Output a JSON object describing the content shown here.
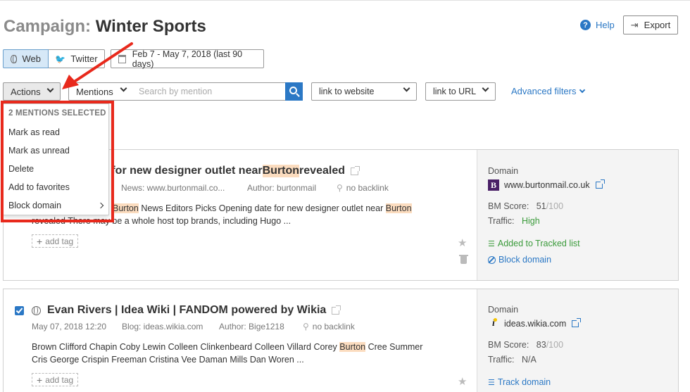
{
  "header": {
    "title_prefix": "Campaign:",
    "title_name": "Winter Sports",
    "help_label": "Help",
    "export_label": "Export"
  },
  "source_tabs": [
    {
      "label": "Web",
      "active": true
    },
    {
      "label": "Twitter",
      "active": false
    }
  ],
  "date_range": "Feb 7 - May 7, 2018 (last 90 days)",
  "filters": {
    "actions_label": "Actions",
    "mentions_label": "Mentions",
    "search_placeholder": "Search by mention",
    "link_to_website": "link to website",
    "link_to_url": "link to URL",
    "advanced_filters": "Advanced filters"
  },
  "actions_menu": {
    "header": "2 MENTIONS SELECTED",
    "items": [
      "Mark as read",
      "Mark as unread",
      "Delete",
      "Add to favorites",
      "Block domain"
    ]
  },
  "mentions": [
    {
      "title_before": "e for new designer outlet near ",
      "title_highlight": "Burton",
      "title_after": " revealed",
      "source": "News: www.burtonmail.co...",
      "author": "Author: burtonmail",
      "backlink": "no backlink",
      "snippet_line1_before": "",
      "snippet_line1_hl1": "Burton",
      "snippet_line1_mid": " News Editors Picks Opening date for new designer outlet near ",
      "snippet_line1_hl2": "Burton",
      "snippet_line2": "revealed There may be a whole host top brands, including Hugo ...",
      "add_tag": "add tag",
      "side": {
        "domain_label": "Domain",
        "domain": "www.burtonmail.co.uk",
        "bm_label": "BM Score:",
        "bm_score": "51",
        "bm_max": "/100",
        "traffic_label": "Traffic:",
        "traffic": "High",
        "tracked": "Added to Tracked list",
        "block": "Block domain"
      }
    },
    {
      "title": "Evan Rivers | Idea Wiki | FANDOM powered by Wikia",
      "date": "May 07, 2018 12:20",
      "source": "Blog: ideas.wikia.com",
      "author": "Author: Bige1218",
      "backlink": "no backlink",
      "snippet_line1_before": "Brown Clifford Chapin Coby Lewin Colleen Clinkenbeard Colleen Villard Corey ",
      "snippet_line1_hl": "Burton",
      "snippet_line1_after": " Cree Summer",
      "snippet_line2": "Cris George Crispin Freeman Cristina Vee Daman Mills Dan Woren ...",
      "add_tag": "add tag",
      "side": {
        "domain_label": "Domain",
        "domain": "ideas.wikia.com",
        "bm_label": "BM Score:",
        "bm_score": "83",
        "bm_max": "/100",
        "traffic_label": "Traffic:",
        "traffic": "N/A",
        "track": "Track domain"
      }
    }
  ],
  "colors": {
    "accent": "#2b78c5",
    "highlight": "#fbdcbf",
    "annotation_red": "#e8291c",
    "positive": "#3a9a3a"
  }
}
